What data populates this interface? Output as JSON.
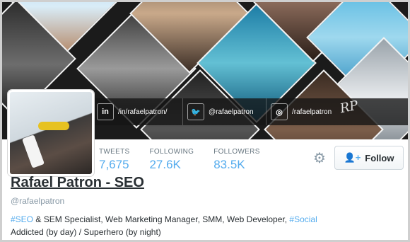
{
  "social": {
    "linkedin": {
      "icon": "linkedin-icon",
      "glyph": "in",
      "label": "/in/rafaelpatron/"
    },
    "twitter": {
      "icon": "twitter-icon",
      "glyph": "🐦",
      "label": "@rafaelpatron"
    },
    "instagram": {
      "icon": "instagram-icon",
      "glyph": "◎",
      "label": "/rafaelpatron"
    }
  },
  "signature": "RP",
  "stats": [
    {
      "label": "TWEETS",
      "value": "7,675"
    },
    {
      "label": "FOLLOWING",
      "value": "27.6K"
    },
    {
      "label": "FOLLOWERS",
      "value": "83.5K"
    }
  ],
  "actions": {
    "settings_icon": "gear-icon",
    "settings_glyph": "⚙",
    "follow_icon": "add-user-icon",
    "follow_glyph": "👤+",
    "follow_label": "Follow"
  },
  "profile": {
    "name": "Rafael Patron - SEO",
    "handle": "@rafaelpatron",
    "bio_line1": {
      "tag1": "#SEO",
      "text": " & SEM Specialist, Web Marketing Manager, SMM, Web Developer, ",
      "tag2": "#Social"
    },
    "bio_line2": "Addicted (by day) / Superhero (by night)"
  },
  "colors": {
    "accent": "#55acee",
    "text": "#292f33",
    "muted": "#8899a6"
  }
}
